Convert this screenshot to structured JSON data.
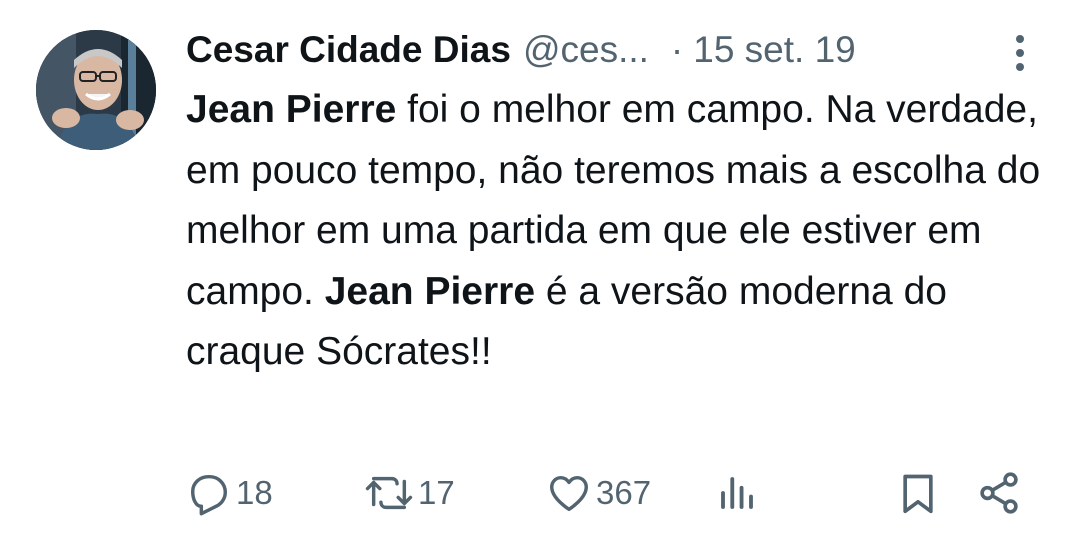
{
  "tweet": {
    "author": {
      "display_name": "Cesar Cidade Dias",
      "handle": "@ces...",
      "avatar_icon": "avatar-photo"
    },
    "separator": "·",
    "timestamp": "15 set. 19",
    "text_segments": [
      {
        "text": "Jean Pierre",
        "bold": true
      },
      {
        "text": " foi o melhor em campo. Na verdade, em pouco tempo, não teremos mais a escolha do melhor em uma partida em que ele estiver em campo. ",
        "bold": false
      },
      {
        "text": "Jean Pierre",
        "bold": true
      },
      {
        "text": " é a versão moderna do craque Sócrates!!",
        "bold": false
      }
    ],
    "actions": {
      "reply_count": "18",
      "retweet_count": "17",
      "like_count": "367",
      "views_icon": "analytics-icon",
      "bookmark_icon": "bookmark-icon",
      "share_icon": "share-icon"
    },
    "colors": {
      "text": "#0f1419",
      "secondary": "#536471"
    }
  }
}
